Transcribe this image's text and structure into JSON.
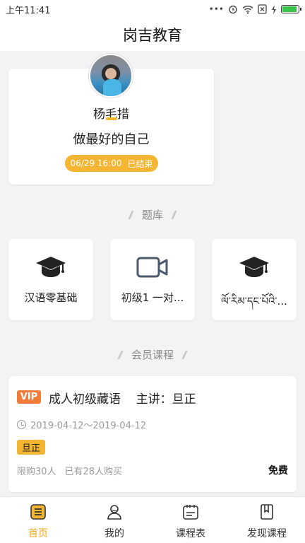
{
  "status_bar": {
    "time": "上午11:41",
    "icons": [
      "dots-icon",
      "alarm-icon",
      "wifi-icon",
      "sim-off-icon",
      "charging-icon",
      "battery-icon"
    ]
  },
  "header": {
    "title": "岗吉教育"
  },
  "live": {
    "teacher_name": "杨毛措",
    "motto": "做最好的自己",
    "time": "06/29 16:00",
    "status": "已结束"
  },
  "question_bank": {
    "section_title": "题库",
    "items": [
      {
        "label": "汉语零基础",
        "icon": "graduation-cap-icon"
      },
      {
        "label": "初级1  一对...",
        "icon": "video-camera-icon"
      },
      {
        "label": "ལོ་རིམ་དང་པོའི་...",
        "icon": "graduation-cap-icon"
      }
    ]
  },
  "member_courses": {
    "section_title": "会员课程",
    "items": [
      {
        "badge": "VIP",
        "title": "成人初级藏语",
        "lecturer_label": "主讲：",
        "lecturer": "旦正",
        "date_range": "2019-04-12～2019-04-12",
        "tag": "旦正",
        "limit": "限购30人",
        "purchased": "已有28人购买",
        "price": "免费"
      }
    ]
  },
  "tabbar": {
    "items": [
      {
        "label": "首页",
        "icon": "home-list-icon",
        "active": true
      },
      {
        "label": "我的",
        "icon": "user-icon",
        "active": false
      },
      {
        "label": "课程表",
        "icon": "schedule-icon",
        "active": false
      },
      {
        "label": "发现课程",
        "icon": "book-icon",
        "active": false
      }
    ]
  },
  "colors": {
    "accent": "#f3b532",
    "vip": "#f07b3a",
    "active_tab": "#f2a91c",
    "background": "#f3f3f5"
  }
}
